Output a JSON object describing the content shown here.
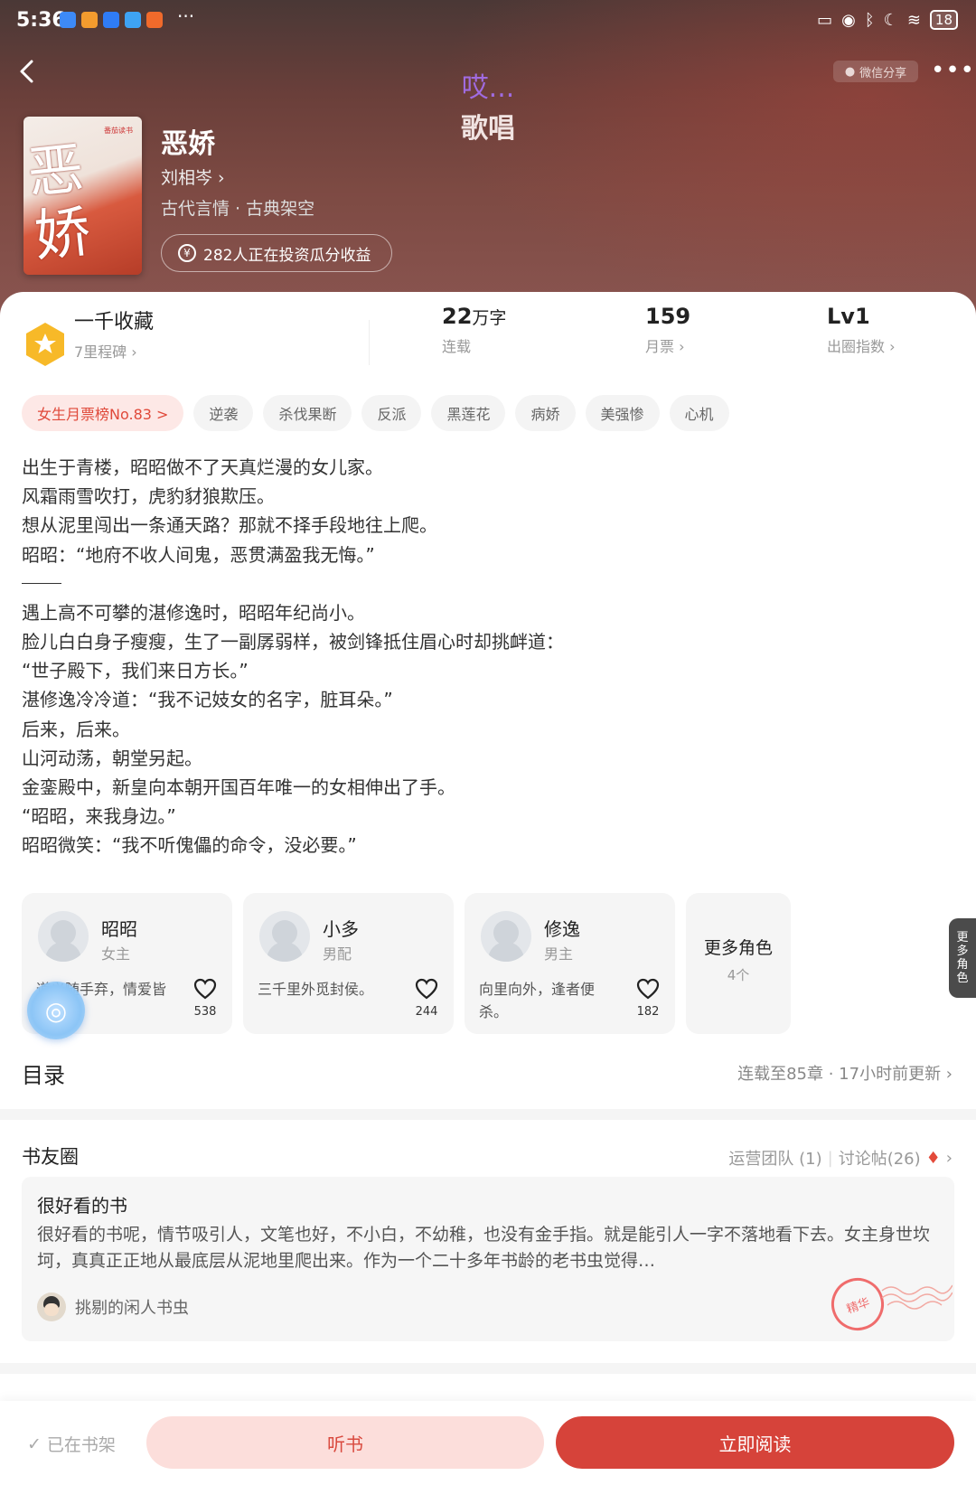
{
  "status": {
    "time": "5:36",
    "battery": "18",
    "overflow": "···"
  },
  "header": {
    "title_line1": "哎...",
    "title_line2": "歌唱",
    "share_label": "微信分享",
    "more": "•••"
  },
  "book": {
    "cover_text": "恶娇",
    "cover_brand": "番茄读书",
    "title": "恶娇",
    "author": "刘相岑 ›",
    "genre": "古代言情 · 古典架空",
    "invest": "282人正在投资瓜分收益"
  },
  "stats": {
    "favorites": {
      "main": "一千收藏",
      "sub": "7里程碑 ›"
    },
    "words": {
      "main_num": "22",
      "main_unit": "万字",
      "sub": "连载"
    },
    "votes": {
      "main": "159",
      "sub": "月票 ›"
    },
    "level": {
      "main": "Lv1",
      "sub": "出圈指数 ›"
    }
  },
  "tags": [
    "女生月票榜No.83 >",
    "逆袭",
    "杀伐果断",
    "反派",
    "黑莲花",
    "病娇",
    "美强惨",
    "心机"
  ],
  "description": {
    "part1": [
      "出生于青楼，昭昭做不了天真烂漫的女儿家。",
      "风霜雨雪吹打，虎豹豺狼欺压。",
      "想从泥里闯出一条通天路？那就不择手段地往上爬。",
      "昭昭：“地府不收人间鬼，恶贯满盈我无悔。”"
    ],
    "part2": [
      "遇上高不可攀的湛修逸时，昭昭年纪尚小。",
      "脸儿白白身子瘦瘦，生了一副孱弱样，被剑锋抵住眉心时却挑衅道：",
      "“世子殿下，我们来日方长。”",
      "湛修逸冷冷道：“我不记妓女的名字，脏耳朵。”",
      "后来，后来。",
      "山河动荡，朝堂另起。",
      "金銮殿中，新皇向本朝开国百年唯一的女相伸出了手。",
      "“昭昭，来我身边。”",
      "昭昭微笑：“我不听傀儡的命令，没必要。”"
    ]
  },
  "roles": [
    {
      "name": "昭昭",
      "role": "女主",
      "quote": "道义随手弃，情爱皆可抛。",
      "likes": "538"
    },
    {
      "name": "小多",
      "role": "男配",
      "quote": "三千里外觅封侯。",
      "likes": "244"
    },
    {
      "name": "修逸",
      "role": "男主",
      "quote": "向里向外，逢者便杀。",
      "likes": "182"
    }
  ],
  "more_roles": {
    "label": "更多角色",
    "count": "4个"
  },
  "side_tab": "更多角色",
  "toc": {
    "title": "目录",
    "info": "连载至85章 · 17小时前更新 ›"
  },
  "circle": {
    "title": "书友圈",
    "ops": "运营团队 (1)",
    "sep": "|",
    "posts": "讨论帖(26)",
    "post": {
      "title": "很好看的书",
      "body": "很好看的书呢，情节吸引人，文笔也好，不小白，不幼稚，也没有金手指。就是能引人一字不落地看下去。女主身世坎坷，真真正正地从最底层从泥地里爬出来。作为一个二十多年书龄的老书虫觉得…",
      "author": "挑剔的闲人书虫",
      "badge": "精华"
    }
  },
  "bottom": {
    "shelf": "已在书架",
    "listen": "听书",
    "read": "立即阅读"
  },
  "colors": {
    "accent": "#d6433a",
    "hero_bg": "#6a3f3a",
    "tag_hot_bg": "#fde8e6"
  }
}
